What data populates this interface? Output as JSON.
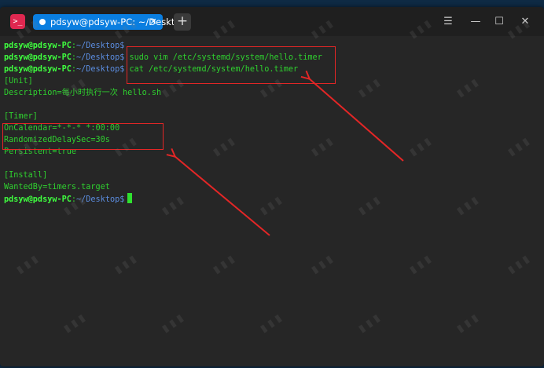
{
  "titlebar": {
    "app_icon_glyph": ">_",
    "tab_title": "pdsyw@pdsyw-PC: ~/Desktop",
    "tab_close_glyph": "✕",
    "new_tab_glyph": "+",
    "menu_glyph": "☰",
    "minimize_glyph": "—",
    "maximize_glyph": "☐",
    "close_glyph": "✕"
  },
  "terminal": {
    "prompt_user": "pdsyw@pdsyw-PC",
    "prompt_sep": ":",
    "prompt_path": "~/Desktop",
    "prompt_end": "$",
    "commands": [
      "",
      " sudo vim /etc/systemd/system/hello.timer",
      " cat /etc/systemd/system/hello.timer"
    ],
    "output": [
      "[Unit]",
      "Description=每小时执行一次 hello.sh",
      "",
      "[Timer]",
      "OnCalendar=*-*-* *:00:00",
      "RandomizedDelaySec=30s",
      "Persistent=true",
      "",
      "[Install]",
      "WantedBy=timers.target"
    ]
  },
  "colors": {
    "prompt_user": "#3fff3f",
    "prompt_path": "#5b8de0",
    "output_text": "#2fd02f",
    "annotation": "#e32626",
    "tab_active": "#0a7ee0"
  }
}
